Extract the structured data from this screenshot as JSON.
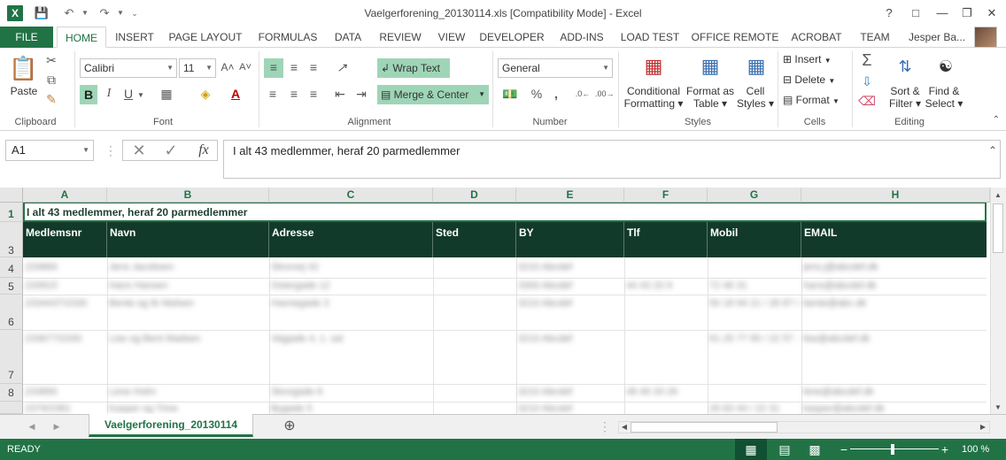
{
  "window": {
    "app_icon": "X",
    "title": "Vaelgerforening_20130114.xls  [Compatibility Mode] - Excel",
    "help": "?",
    "minimize": "—",
    "restore": "❐",
    "close": "✕"
  },
  "tabs": [
    "FILE",
    "HOME",
    "INSERT",
    "PAGE LAYOUT",
    "FORMULAS",
    "DATA",
    "REVIEW",
    "VIEW",
    "DEVELOPER",
    "ADD-INS",
    "LOAD TEST",
    "OFFICE REMOTE",
    "ACROBAT",
    "TEAM"
  ],
  "active_tab": "HOME",
  "user": "Jesper Ba...",
  "ribbon": {
    "clipboard": {
      "paste": "Paste",
      "label": "Clipboard"
    },
    "font": {
      "name": "Calibri",
      "size": "11",
      "bold": "B",
      "italic": "I",
      "underline": "U",
      "grow": "A˄",
      "shrink": "A˅",
      "label": "Font"
    },
    "alignment": {
      "wrap": "Wrap Text",
      "merge": "Merge & Center",
      "label": "Alignment"
    },
    "number": {
      "format": "General",
      "percent": "%",
      "comma": ",",
      "label": "Number"
    },
    "styles": {
      "conditional": "Conditional",
      "formatting": "Formatting",
      "format_as": "Format as",
      "table": "Table",
      "cell": "Cell",
      "cell_styles": "Styles",
      "label": "Styles"
    },
    "cells": {
      "insert": "Insert",
      "delete": "Delete",
      "format": "Format",
      "label": "Cells"
    },
    "editing": {
      "sum": "Σ",
      "sort": "Sort &",
      "filter": "Filter",
      "find": "Find &",
      "select": "Select",
      "label": "Editing"
    }
  },
  "formula_bar": {
    "name_box": "A1",
    "fx": "fx",
    "content": "I alt 43 medlemmer, heraf 20 parmedlemmer"
  },
  "columns": [
    "A",
    "B",
    "C",
    "D",
    "E",
    "F",
    "G",
    "H"
  ],
  "rows": [
    "1",
    "3",
    "4",
    "5",
    "6",
    "7",
    "8"
  ],
  "sheet": {
    "title_cell": "I alt 43 medlemmer, heraf 20 parmedlemmer",
    "headers": [
      "Medlemsnr",
      "Navn",
      "Adresse",
      "Sted",
      "BY",
      "Tlf",
      "Mobil",
      "EMAIL"
    ],
    "blurred_rows": [
      [
        "233884",
        "Jens Jacobsen",
        "Skovvej 42",
        "",
        "3210 Abcdef",
        "",
        "",
        "jens.j@abcdef.dk"
      ],
      [
        "233915",
        "Hans Hansen",
        "Ostergade 12",
        "",
        "3300 Abcdef",
        "44 43 20 9",
        "72 46 31",
        "hans@abcdef.dk"
      ],
      [
        "2334437/2330",
        "Bente og Ib Nielsen",
        "Havnegade 3",
        "",
        "3210 Abcdef",
        "",
        "50 18 94 21 / 28 87 88",
        "bente@abc.dk"
      ],
      [
        "233677/2330",
        "Lise og Bent Madsen",
        "Vejgade 4, 1. sal",
        "",
        "3210 Abcdef",
        "",
        "61 25 77 95 / 22 57 11",
        "lise@abcdef.dk"
      ],
      [
        "233890",
        "Lene Holm",
        "Skovgade 8",
        "",
        "3210 Abcdef",
        "48 46 33 26",
        "",
        "lene@abcdef.dk"
      ],
      [
        "2379/2381",
        "Kasper og Trine",
        "Bygade 5",
        "",
        "3210 Abcdef",
        "",
        "26 83 44 / 22 31",
        "kasper@abcdef.dk"
      ]
    ]
  },
  "sheet_tab": "Vaelgerforening_20130114",
  "status": {
    "mode": "READY",
    "zoom": "100 %"
  }
}
